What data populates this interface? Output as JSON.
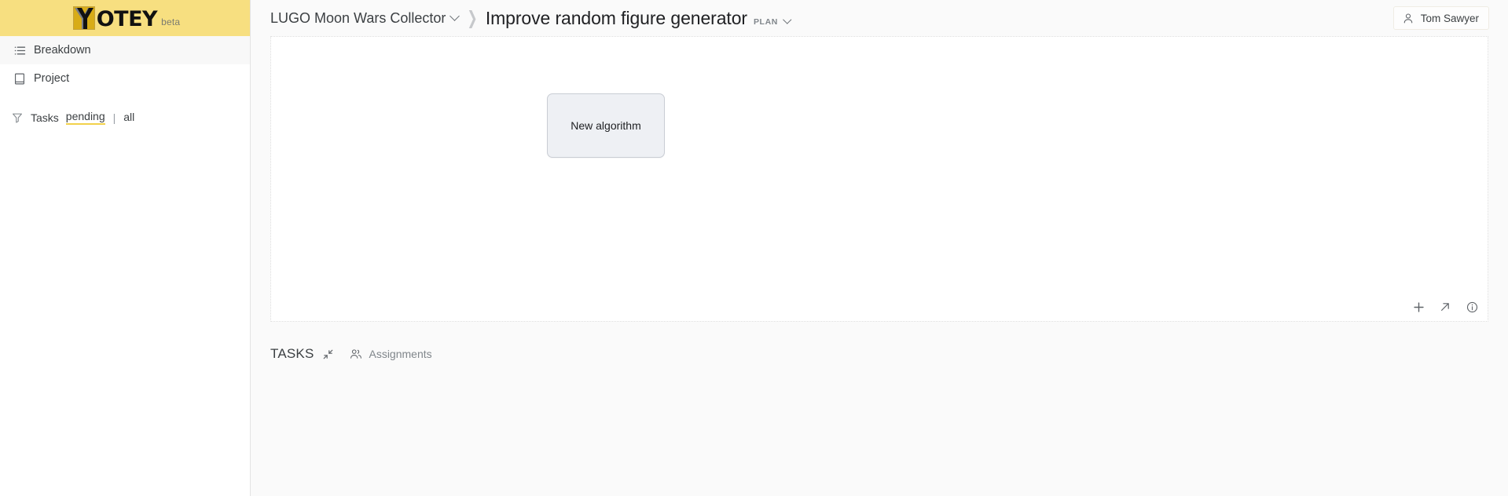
{
  "brand": {
    "name": "OTEY",
    "mark_letter": "Y",
    "beta_label": "beta",
    "bar_color": "#f7df80"
  },
  "sidebar": {
    "items": [
      {
        "label": "Breakdown",
        "icon": "list-icon",
        "active": true
      },
      {
        "label": "Project",
        "icon": "book-icon",
        "active": false
      }
    ],
    "filter": {
      "icon": "funnel-icon",
      "label": "Tasks",
      "options": [
        {
          "label": "pending",
          "selected": true
        },
        {
          "label": "all",
          "selected": false
        }
      ],
      "separator": "|",
      "underline_color": "#f2d14b"
    }
  },
  "topbar": {
    "breadcrumb": {
      "project": "LUGO Moon Wars Collector",
      "separator": "❯",
      "task": "Improve random figure generator",
      "task_badge": "PLAN"
    },
    "user": {
      "name": "Tom Sawyer",
      "icon": "user-icon"
    }
  },
  "canvas": {
    "nodes": [
      {
        "label": "New algorithm"
      }
    ],
    "tools": [
      {
        "name": "add-node-button",
        "icon": "plus-icon"
      },
      {
        "name": "expand-button",
        "icon": "arrow-up-right-icon"
      },
      {
        "name": "info-button",
        "icon": "info-circle-icon"
      }
    ]
  },
  "tasks": {
    "title": "TASKS",
    "collapse_icon": "collapse-icon",
    "assignments_label": "Assignments",
    "assignments_icon": "users-icon"
  }
}
